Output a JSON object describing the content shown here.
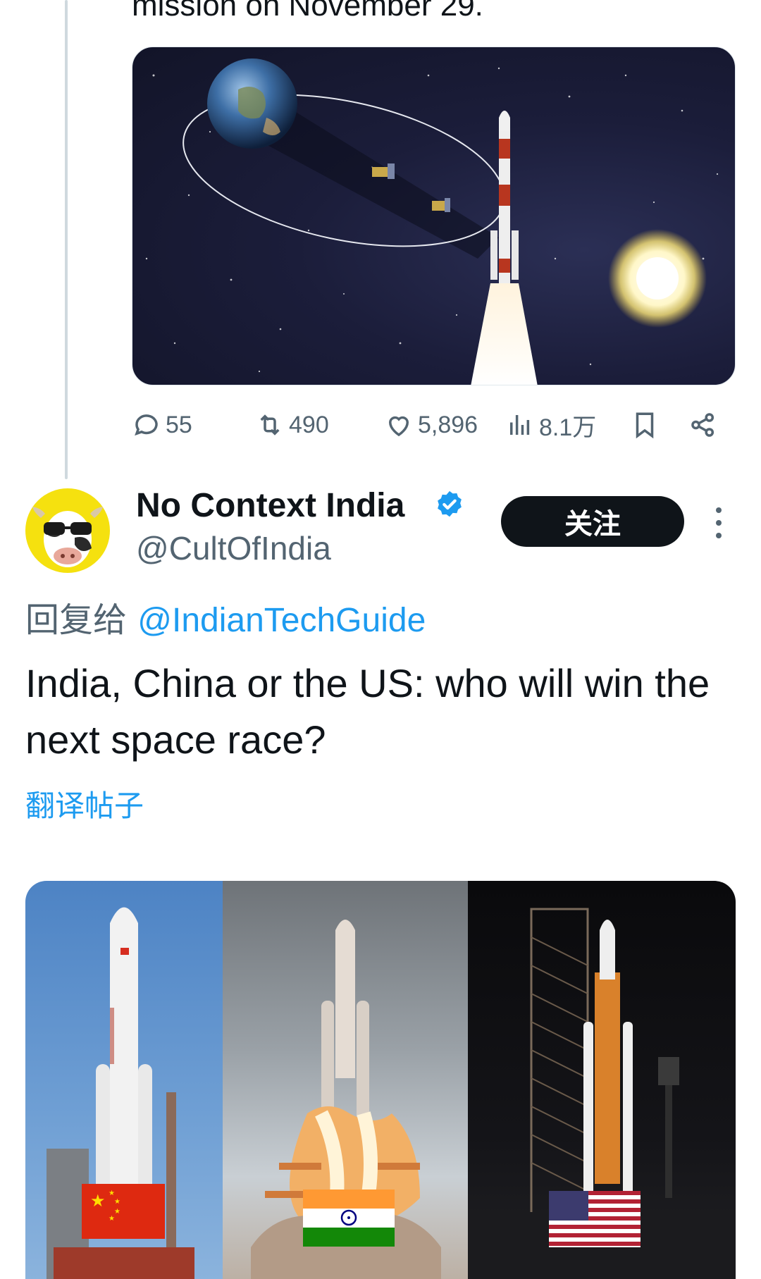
{
  "previous_tweet": {
    "text_tail": "mission on November 29.",
    "actions": {
      "replies": "55",
      "retweets": "490",
      "likes": "5,896",
      "views": "8.1万"
    }
  },
  "tweet": {
    "display_name": "No Context India",
    "handle": "@CultOfIndia",
    "follow_label": "关注",
    "reply_prefix": "回复给",
    "reply_to": "@IndianTechGuide",
    "text": "India, China or the US: who will win the next space race?",
    "translate_label": "翻译帖子"
  },
  "colors": {
    "accent": "#1d9bf0",
    "text_primary": "#0f1419",
    "text_secondary": "#536471",
    "follow_bg": "#0f1419"
  },
  "icons": [
    "reply-icon",
    "retweet-icon",
    "like-icon",
    "views-icon",
    "bookmark-icon",
    "share-icon",
    "verified-badge-icon",
    "more-icon"
  ]
}
